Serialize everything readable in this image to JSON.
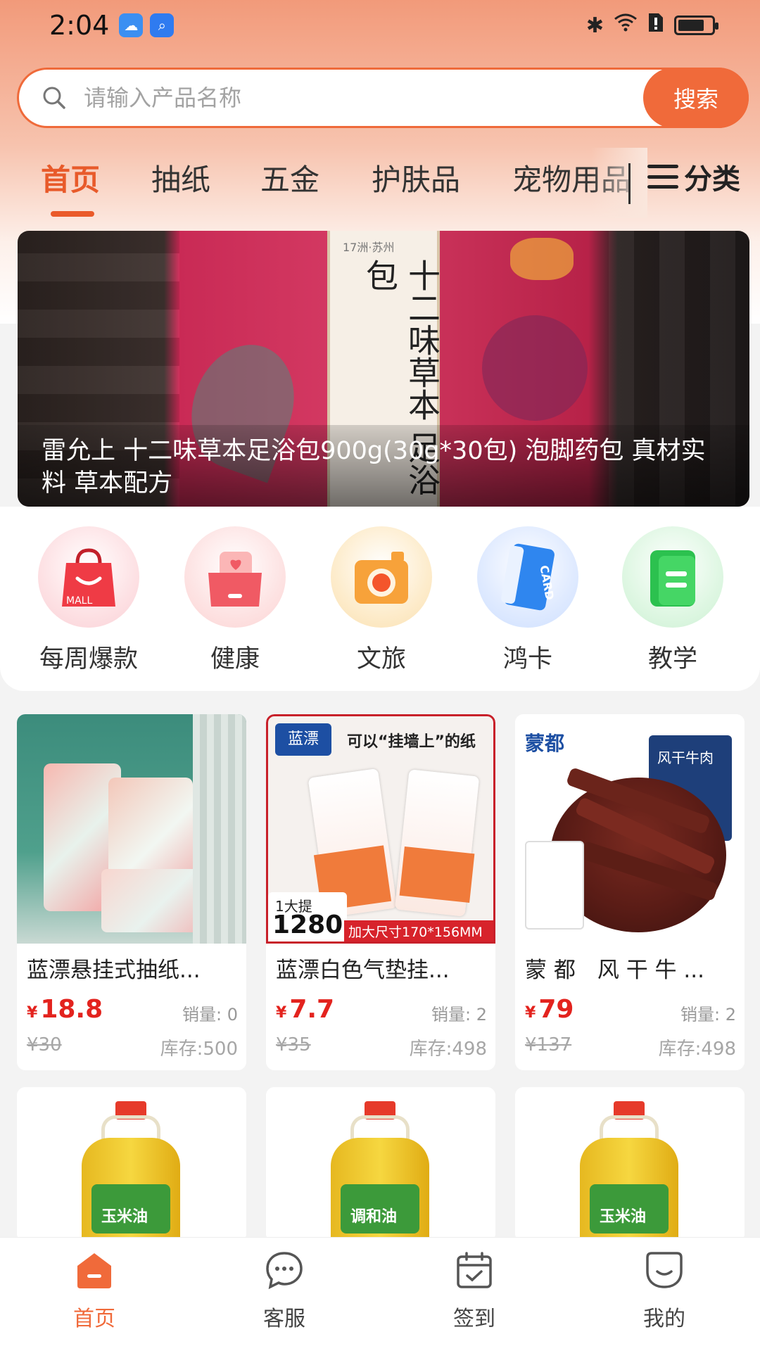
{
  "status_bar": {
    "time": "2:04"
  },
  "search": {
    "placeholder": "请输入产品名称",
    "button_label": "搜索"
  },
  "tabs": [
    {
      "label": "首页",
      "active": true
    },
    {
      "label": "抽纸"
    },
    {
      "label": "五金"
    },
    {
      "label": "护肤品"
    },
    {
      "label": "宠物用品"
    }
  ],
  "category_label": "分类",
  "banner": {
    "caption": "雷允上 十二味草本足浴包900g(30g*30包) 泡脚药包 真材实料 草本配方",
    "package_text": "十二味草本 足浴包",
    "package_brand": "17洲·苏州"
  },
  "quick_links": [
    {
      "label": "每周爆款",
      "icon": "shopping-bag-icon",
      "color": "#ef4b52"
    },
    {
      "label": "健康",
      "icon": "heart-card-icon",
      "color": "#f46a6a"
    },
    {
      "label": "文旅",
      "icon": "camera-icon",
      "color": "#f7a23a"
    },
    {
      "label": "鸿卡",
      "icon": "card-icon",
      "color": "#3a8cf0"
    },
    {
      "label": "教学",
      "icon": "book-icon",
      "color": "#34c25a"
    }
  ],
  "products": [
    {
      "title": "蓝漂悬挂式抽纸...",
      "price": "18.8",
      "currency": "¥",
      "original_price": "¥30",
      "sales": "销量: 0",
      "stock": "库存:500",
      "img_badge": ""
    },
    {
      "title": "蓝漂白色气垫挂...",
      "price": "7.7",
      "currency": "¥",
      "original_price": "¥35",
      "sales": "销量: 2",
      "stock": "库存:498",
      "img_badge_1": "可以“挂墙上”的纸",
      "img_badge_2": "1280",
      "img_badge_3": "加大尺寸170*156MM",
      "img_badge_4": "1大提"
    },
    {
      "title": "蒙 都　风 干 牛 ...",
      "price": "79",
      "currency": "¥",
      "original_price": "¥137",
      "sales": "销量: 2",
      "stock": "库存:498",
      "img_badge_1": "风干牛肉",
      "img_badge_2": "蒙都"
    },
    {
      "title": "",
      "img_label": "玉米油"
    },
    {
      "title": "",
      "img_label": "调和油"
    },
    {
      "title": "",
      "img_label": "玉米油"
    }
  ],
  "bottom_nav": [
    {
      "label": "首页",
      "icon": "home-icon",
      "active": true
    },
    {
      "label": "客服",
      "icon": "chat-icon"
    },
    {
      "label": "签到",
      "icon": "calendar-check-icon"
    },
    {
      "label": "我的",
      "icon": "profile-icon"
    }
  ],
  "colors": {
    "accent": "#f06a3a",
    "price": "#e3231e"
  }
}
